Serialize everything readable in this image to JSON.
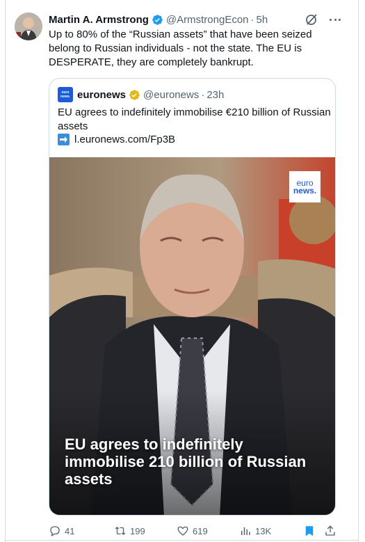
{
  "author": {
    "name": "Martin A. Armstrong",
    "handle": "@ArmstrongEcon",
    "time": "5h"
  },
  "tweet": {
    "text": "Up to 80% of the “Russian assets” that have been seized belong to Russian individuals - not the state. The EU is DESPERATE, they are completely bankrupt."
  },
  "quote": {
    "name": "euronews",
    "handle": "@euronews",
    "time": "23h",
    "text": "EU agrees to indefinitely immobilise €210 billion of Russian assets",
    "link": "l.euronews.com/Fp3B",
    "logo_line1": "euro",
    "logo_line2": "news.",
    "media_caption": "EU agrees to indefinitely immobilise   210 billion of Russian assets"
  },
  "actions": {
    "replies": "41",
    "reposts": "199",
    "likes": "619",
    "views": "13K"
  },
  "separator": "·",
  "colors": {
    "verified_blue": "#1d9bf0",
    "verified_gold": "#e2b719",
    "bookmark_blue": "#1d9bf0",
    "secondary_text": "#536471"
  },
  "icons": [
    "verified-badge-icon",
    "grok-icon",
    "more-icon",
    "link-arrow-icon",
    "reply-icon",
    "repost-icon",
    "like-icon",
    "views-icon",
    "bookmark-icon",
    "share-icon"
  ]
}
